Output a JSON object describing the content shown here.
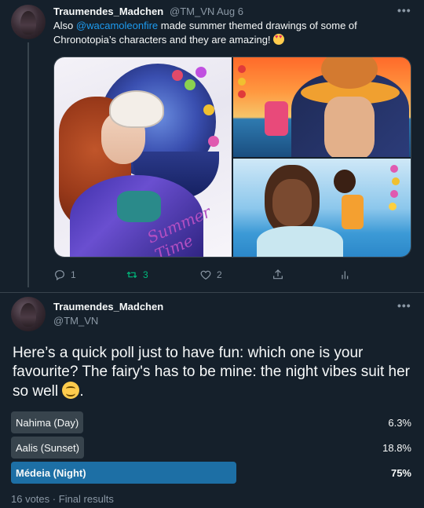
{
  "tweet1": {
    "author_name": "Traumendes_Madchen",
    "handle": "@TM_VN",
    "separator": "·",
    "date": "Aug 6",
    "more": "•••",
    "text_before": "Also ",
    "mention": "@wacamoleonfire",
    "text_after": "  made summer themed drawings of some of Chronotopia’s characters and they are amazing! ",
    "emoji": "heart-eyes-emoji",
    "image_a_signature": "Summer Time",
    "actions": {
      "replies": "1",
      "retweets": "3",
      "likes": "2"
    }
  },
  "tweet2": {
    "author_name": "Traumendes_Madchen",
    "handle": "@TM_VN",
    "more": "•••",
    "text": "Here’s a quick poll just to have fun: which one is your favourite? The fairy's has to be mine: the night vibes suit her so well ",
    "emoji": "smiling-face-emoji",
    "poll": {
      "options": [
        {
          "label": "Nahima (Day)",
          "percent_label": "6.3%",
          "percent": 6.3,
          "winner": false
        },
        {
          "label": "Aalis (Sunset)",
          "percent_label": "18.8%",
          "percent": 18.8,
          "winner": false
        },
        {
          "label": "Médeia (Night)",
          "percent_label": "75%",
          "percent": 75,
          "winner": true
        }
      ],
      "votes": "16 votes",
      "separator": "·",
      "status": "Final results"
    }
  },
  "colors": {
    "background": "#15202b",
    "text": "#f7f9f9",
    "muted": "#8b98a5",
    "accent": "#1d9bf0",
    "retweet": "#00ba7c",
    "poll_bar": "#38444d",
    "poll_winner": "#1d6fa5"
  }
}
